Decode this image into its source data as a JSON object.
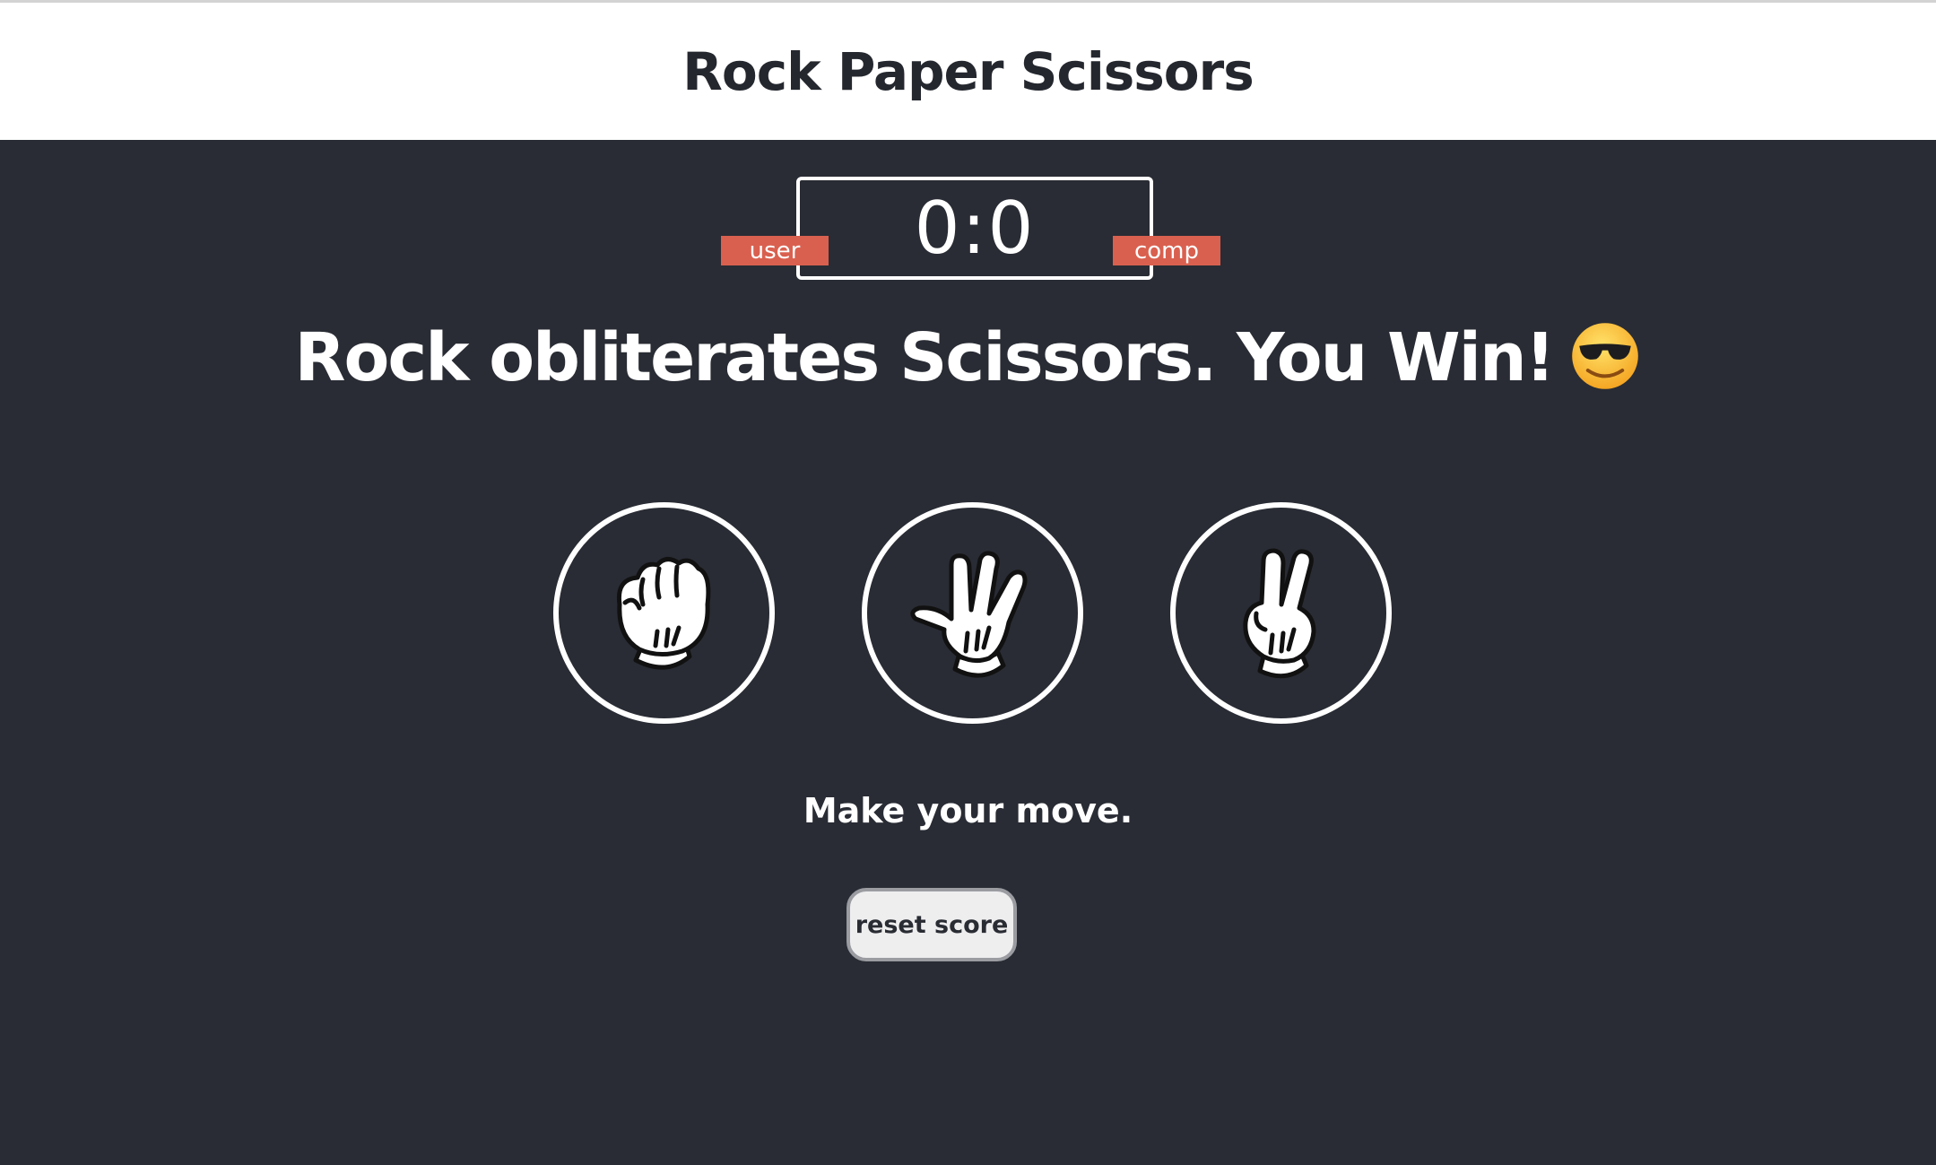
{
  "header": {
    "title": "Rock Paper Scissors"
  },
  "scoreboard": {
    "score": "0:0",
    "user_label": "user",
    "comp_label": "comp"
  },
  "result": {
    "message": "Rock obliterates Scissors. You Win!",
    "emoji": "smiling-face-with-sunglasses-icon"
  },
  "choices": [
    {
      "name": "rock",
      "icon": "rock-fist-glove-icon"
    },
    {
      "name": "paper",
      "icon": "paper-hand-glove-icon"
    },
    {
      "name": "scissors",
      "icon": "scissors-fingers-glove-icon"
    }
  ],
  "prompt": "Make your move.",
  "reset_label": "reset score",
  "colors": {
    "background": "#292c34",
    "header_background": "#ffffff",
    "badge": "#d9604f",
    "text": "#ffffff"
  }
}
